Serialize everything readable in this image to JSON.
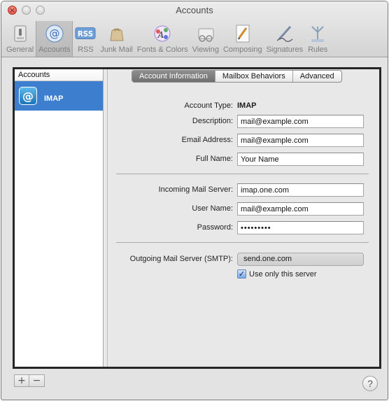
{
  "window": {
    "title": "Accounts"
  },
  "toolbar": {
    "items": [
      {
        "label": "General",
        "icon": "general-switch-icon"
      },
      {
        "label": "Accounts",
        "icon": "at-sign-icon"
      },
      {
        "label": "RSS",
        "icon": "rss-icon"
      },
      {
        "label": "Junk Mail",
        "icon": "junk-mail-bag-icon"
      },
      {
        "label": "Fonts & Colors",
        "icon": "font-palette-icon"
      },
      {
        "label": "Viewing",
        "icon": "viewing-glasses-icon"
      },
      {
        "label": "Composing",
        "icon": "composing-pencil-icon"
      },
      {
        "label": "Signatures",
        "icon": "signature-pen-icon"
      },
      {
        "label": "Rules",
        "icon": "rules-icon"
      }
    ],
    "active_index": 1,
    "rss_badge": "RSS"
  },
  "sidebar": {
    "header": "Accounts",
    "accounts": [
      {
        "name": "IMAP",
        "icon": "at-sign-icon",
        "selected": true
      }
    ],
    "at_glyph": "@"
  },
  "tabs": [
    "Account Information",
    "Mailbox Behaviors",
    "Advanced"
  ],
  "active_tab": "Account Information",
  "form": {
    "account_type_label": "Account Type:",
    "account_type_value": "IMAP",
    "description_label": "Description:",
    "description_value": "mail@example.com",
    "email_label": "Email Address:",
    "email_value": "mail@example.com",
    "fullname_label": "Full Name:",
    "fullname_value": "Your Name",
    "incoming_label": "Incoming Mail Server:",
    "incoming_value": "imap.one.com",
    "username_label": "User Name:",
    "username_value": "mail@example.com",
    "password_label": "Password:",
    "password_value": "•••••••••",
    "smtp_label": "Outgoing Mail Server (SMTP):",
    "smtp_value": "send.one.com",
    "use_only_label": "Use only this server",
    "use_only_checked": true
  },
  "footer": {
    "add": "+",
    "remove": "−",
    "help": "?"
  },
  "colors": {
    "selection": "#3e7ecf",
    "window_bg": "#e3e3e3",
    "frame": "#262626"
  }
}
